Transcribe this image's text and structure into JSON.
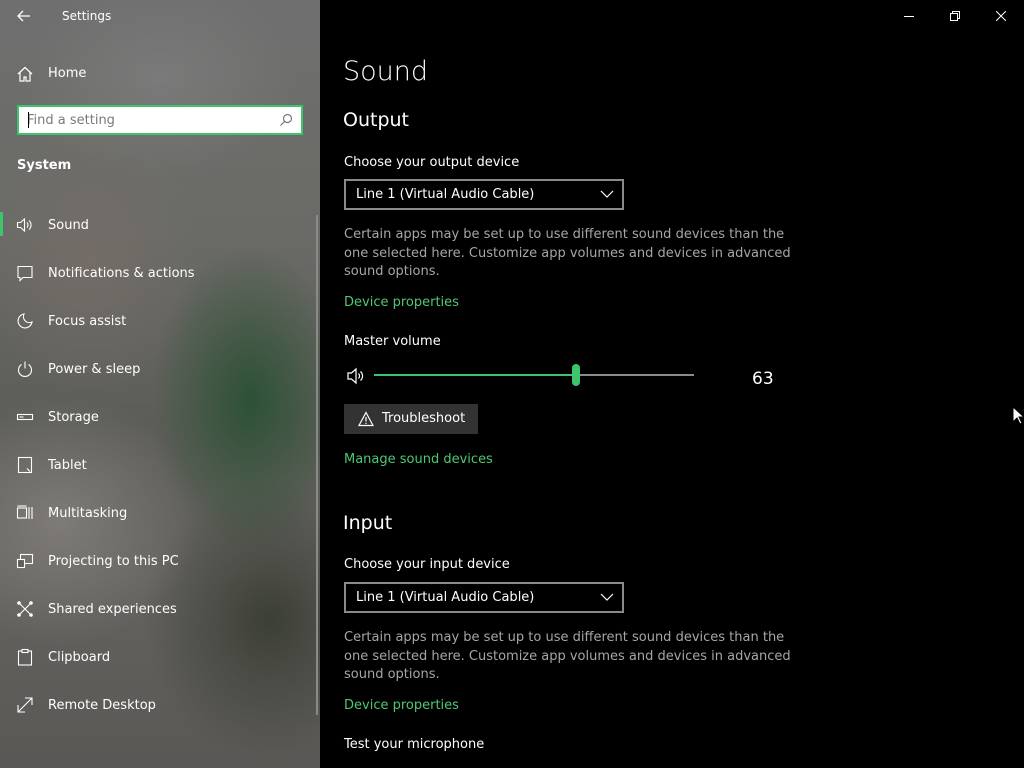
{
  "window": {
    "title": "Settings",
    "controls": [
      "minimize",
      "restore",
      "close"
    ]
  },
  "sidebar": {
    "home_label": "Home",
    "search": {
      "placeholder": "Find a setting",
      "value": ""
    },
    "section_title": "System",
    "items": [
      {
        "label": "Sound",
        "icon": "speaker-icon",
        "active": true
      },
      {
        "label": "Notifications & actions",
        "icon": "notification-icon",
        "active": false
      },
      {
        "label": "Focus assist",
        "icon": "moon-icon",
        "active": false
      },
      {
        "label": "Power & sleep",
        "icon": "power-icon",
        "active": false
      },
      {
        "label": "Storage",
        "icon": "storage-icon",
        "active": false
      },
      {
        "label": "Tablet",
        "icon": "tablet-icon",
        "active": false
      },
      {
        "label": "Multitasking",
        "icon": "multitasking-icon",
        "active": false
      },
      {
        "label": "Projecting to this PC",
        "icon": "projecting-icon",
        "active": false
      },
      {
        "label": "Shared experiences",
        "icon": "shared-icon",
        "active": false
      },
      {
        "label": "Clipboard",
        "icon": "clipboard-icon",
        "active": false
      },
      {
        "label": "Remote Desktop",
        "icon": "remote-desktop-icon",
        "active": false
      }
    ]
  },
  "main": {
    "page_title": "Sound",
    "output": {
      "heading": "Output",
      "device_label": "Choose your output device",
      "device_value": "Line 1 (Virtual Audio Cable)",
      "description": "Certain apps may be set up to use different sound devices than the one selected here. Customize app volumes and devices in advanced sound options.",
      "device_properties_link": "Device properties",
      "master_volume_label": "Master volume",
      "master_volume_value": "63",
      "master_volume_percent": 63,
      "troubleshoot_label": "Troubleshoot",
      "manage_link": "Manage sound devices"
    },
    "input": {
      "heading": "Input",
      "device_label": "Choose your input device",
      "device_value": "Line 1 (Virtual Audio Cable)",
      "description": "Certain apps may be set up to use different sound devices than the one selected here. Customize app volumes and devices in advanced sound options.",
      "device_properties_link": "Device properties",
      "test_mic_label": "Test your microphone"
    }
  },
  "colors": {
    "accent": "#3ec46d",
    "link": "#4fc874",
    "background": "#000000",
    "secondary_text": "#a6a6a6"
  }
}
